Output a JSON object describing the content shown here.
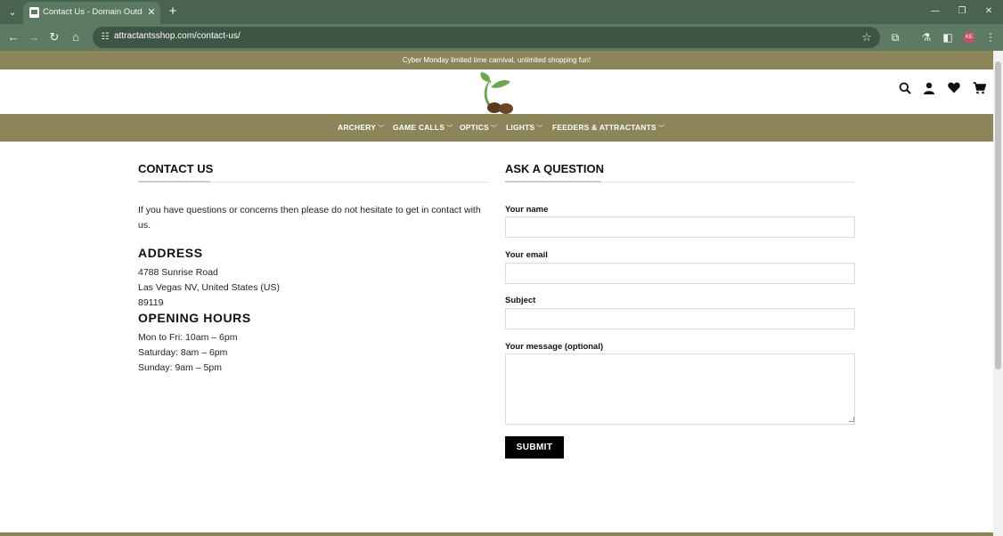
{
  "browser": {
    "tab_title": "Contact Us - Domain Outdoor",
    "url": "attractantsshop.com/contact-us/",
    "profile_initials": "KE"
  },
  "site": {
    "promo": "Cyber Monday limited time carnival, unlimited shopping fun!",
    "menu": [
      {
        "label": "ARCHERY"
      },
      {
        "label": "GAME CALLS"
      },
      {
        "label": "OPTICS"
      },
      {
        "label": "LIGHTS"
      },
      {
        "label": "FEEDERS & ATTRACTANTS"
      }
    ],
    "colors": {
      "brand": "#8b8559",
      "chrome": "#5d7a63"
    }
  },
  "contact": {
    "title": "CONTACT US",
    "intro": "If you have questions or concerns then please do not hesitate to get in contact with us.",
    "address_heading": "ADDRESS",
    "address_lines": [
      "4788 Sunrise Road",
      "Las Vegas NV, United States (US)",
      "89119"
    ],
    "hours_heading": "OPENING HOURS",
    "hours_lines": [
      "Mon to Fri: 10am – 6pm",
      "Saturday: 8am – 6pm",
      "Sunday: 9am – 5pm"
    ]
  },
  "form": {
    "title": "ASK A QUESTION",
    "name_label": "Your name",
    "email_label": "Your email",
    "subject_label": "Subject",
    "message_label": "Your message (optional)",
    "name_value": "",
    "email_value": "",
    "subject_value": "",
    "submit_label": "SUBMIT"
  }
}
